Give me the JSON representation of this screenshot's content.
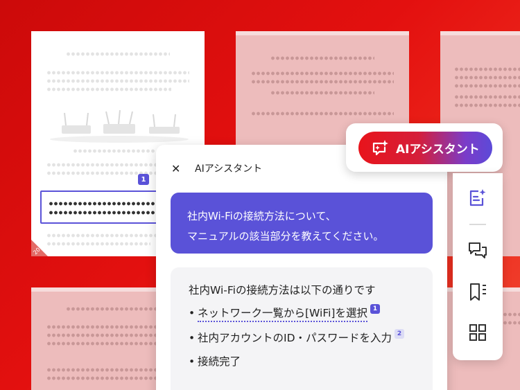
{
  "document": {
    "page_number": "20",
    "reference_badge": "1"
  },
  "assistant_panel": {
    "title": "AIアシスタント",
    "user_message": {
      "line1": "社内Wi-Fiの接続方法について、",
      "line2": "マニュアルの該当部分を教えてください。"
    },
    "answer": {
      "intro": "社内Wi-Fiの接続方法は以下の通りです",
      "items": [
        {
          "bullet": "•",
          "text": "ネットワーク一覧から[WiFi]を選択",
          "ref": "1"
        },
        {
          "bullet": "•",
          "text": "社内アカウントのID・パスワードを入力",
          "ref": "2"
        },
        {
          "bullet": "•",
          "text": "接続完了",
          "ref": ""
        }
      ]
    }
  },
  "ai_button": {
    "label": "AIアシスタント",
    "icon": "sparkle-chat-icon"
  },
  "sidebar": {
    "icons": [
      "ai-assistant-icon",
      "comments-icon",
      "bookmark-list-icon",
      "grid-view-icon"
    ]
  },
  "colors": {
    "background_red": "#e3100f",
    "accent_purple": "#5a52d8",
    "ref_inactive": "#dcdcf5"
  }
}
